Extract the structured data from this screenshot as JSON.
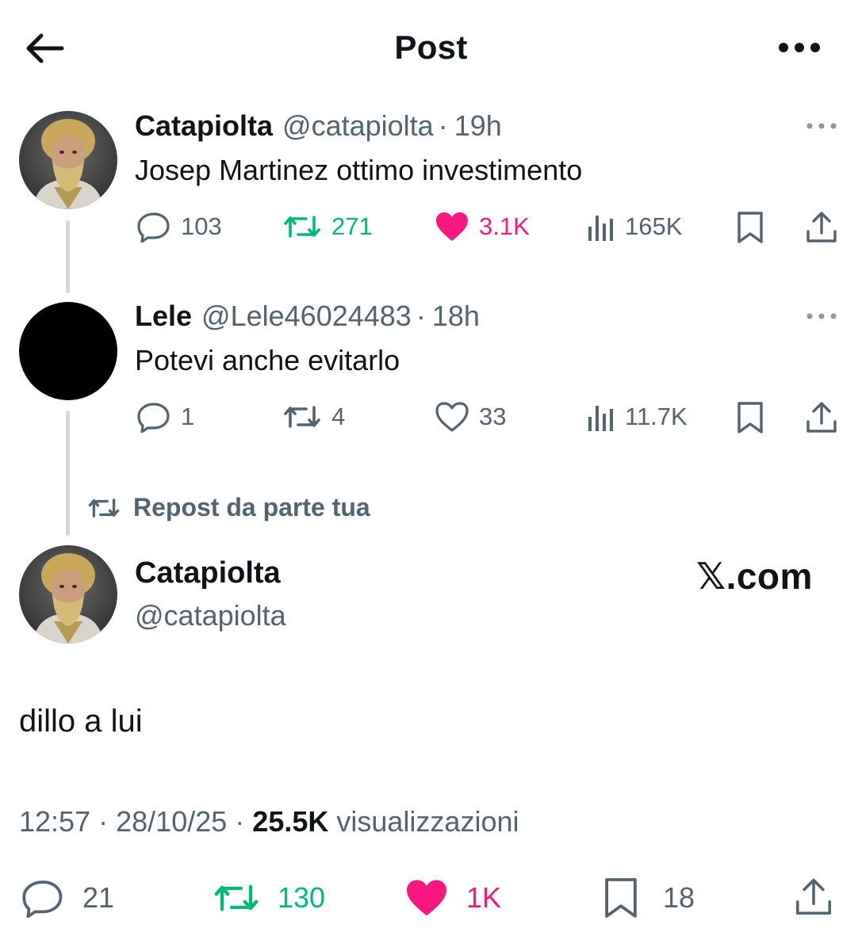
{
  "header": {
    "title": "Post"
  },
  "parent_tweet": {
    "display_name": "Catapiolta",
    "handle": "@catapiolta",
    "separator": "·",
    "time": "19h",
    "text": "Josep Martinez ottimo investimento",
    "replies": "103",
    "reposts": "271",
    "likes": "3.1K",
    "views": "165K"
  },
  "reply_tweet": {
    "display_name": "Lele",
    "handle": "@Lele46024483",
    "separator": "·",
    "time": "18h",
    "text": "Potevi anche evitarlo",
    "replies": "1",
    "reposts": "4",
    "likes": "33",
    "views": "11.7K"
  },
  "repost_banner": {
    "label": "Repost da parte tua"
  },
  "main_tweet": {
    "display_name": "Catapiolta",
    "handle": "@catapiolta",
    "watermark_x": "𝕏",
    "watermark_suffix": ".com",
    "text": "dillo a lui",
    "time": "12:57",
    "separator": "·",
    "date": "28/10/25",
    "views_count": "25.5K",
    "views_label": "visualizzazioni",
    "replies": "21",
    "reposts": "130",
    "likes": "1K",
    "bookmarks": "18"
  },
  "colors": {
    "text_primary": "#0f1419",
    "text_secondary": "#536471",
    "repost_green": "#00ba7c",
    "like_pink": "#f91880",
    "thread_line": "#cfd9de"
  },
  "icons": {
    "back": "arrow-left-icon",
    "more": "more-horizontal-icon",
    "reply": "reply-icon",
    "repost": "repost-icon",
    "like": "heart-icon",
    "views": "views-icon",
    "bookmark": "bookmark-icon",
    "share": "share-icon"
  }
}
